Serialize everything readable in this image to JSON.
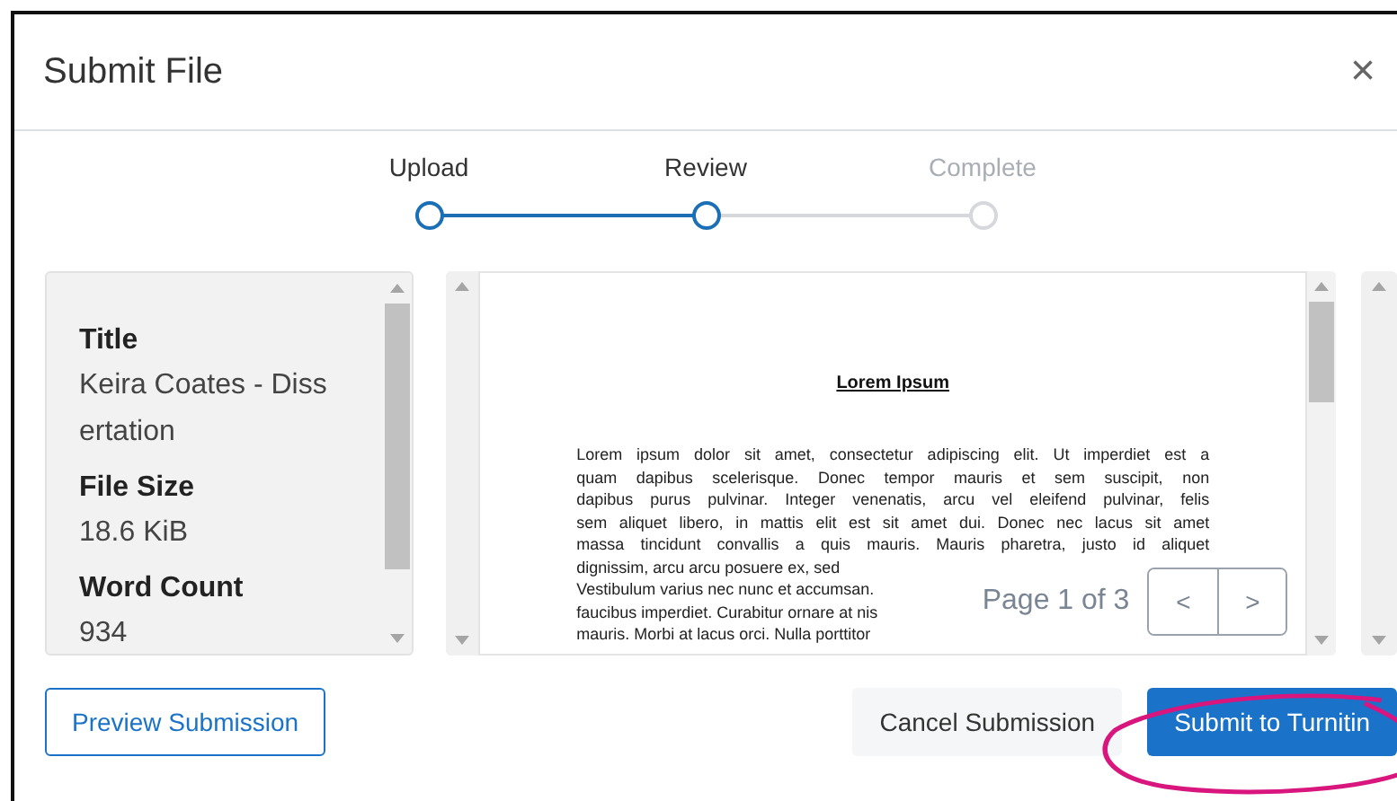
{
  "dialog": {
    "title": "Submit File",
    "close": "×"
  },
  "steps": [
    {
      "label": "Upload",
      "reached": true
    },
    {
      "label": "Review",
      "reached": true
    },
    {
      "label": "Complete",
      "reached": false
    }
  ],
  "details": [
    {
      "label": "Title",
      "value": "Keira Coates - Dissertation"
    },
    {
      "label": "File Size",
      "value": "18.6 KiB"
    },
    {
      "label": "Word Count",
      "value": "934"
    }
  ],
  "preview": {
    "heading": "Lorem Ipsum",
    "lines": [
      {
        "text": "Lorem ipsum dolor sit amet, consectetur adipiscing elit. Ut imperdiet est a",
        "kind": "full"
      },
      {
        "text": "quam dapibus scelerisque. Donec tempor mauris et sem suscipit, non",
        "kind": "full"
      },
      {
        "text": "dapibus purus pulvinar. Integer venenatis, arcu vel eleifend pulvinar, felis",
        "kind": "full"
      },
      {
        "text": "sem aliquet libero, in mattis elit est sit amet dui. Donec nec lacus sit amet",
        "kind": "full"
      },
      {
        "text": "massa tincidunt convallis a quis mauris. Mauris pharetra, justo id aliquet",
        "kind": "full"
      },
      {
        "text": "dignissim, arcu arcu posuere ex, sed",
        "kind": "cut"
      },
      {
        "text": "Vestibulum varius nec nunc et accumsan.",
        "kind": "cut"
      },
      {
        "text": "faucibus imperdiet. Curabitur ornare at nis",
        "kind": "cut"
      },
      {
        "text": "mauris. Morbi at lacus orci. Nulla porttitor",
        "kind": "cut"
      }
    ],
    "pager": {
      "label": "Page 1 of 3",
      "prev": "<",
      "next": ">"
    }
  },
  "buttons": [
    {
      "label": "Preview Submission",
      "kind": "outline"
    },
    {
      "label": "Cancel Submission",
      "kind": "plain"
    },
    {
      "label": "Submit to Turnitin",
      "kind": "primary"
    }
  ]
}
